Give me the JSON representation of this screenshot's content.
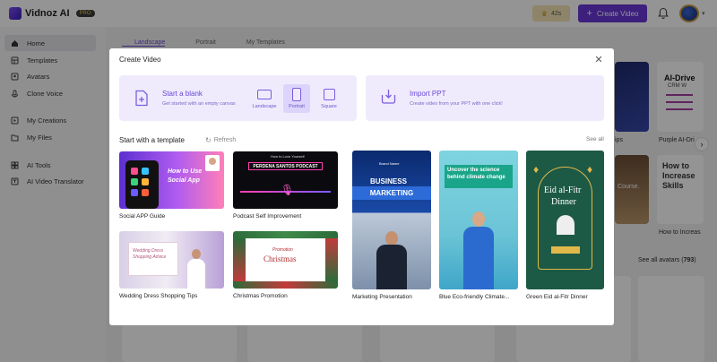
{
  "app": {
    "name": "Vidnoz AI",
    "badge": "PRO"
  },
  "topbar": {
    "credits": "42s",
    "create_label": "Create Video"
  },
  "sidebar": {
    "items": [
      {
        "label": "Home",
        "icon": "home-icon"
      },
      {
        "label": "Templates",
        "icon": "templates-icon"
      },
      {
        "label": "Avatars",
        "icon": "avatars-icon"
      },
      {
        "label": "Clone Voice",
        "icon": "voice-icon"
      },
      {
        "label": "My Creations",
        "icon": "creations-icon"
      },
      {
        "label": "My Files",
        "icon": "files-icon"
      },
      {
        "label": "AI Tools",
        "icon": "tools-icon"
      },
      {
        "label": "AI Video Translator",
        "icon": "translator-icon"
      }
    ]
  },
  "background": {
    "tabs": [
      "Landscape",
      "Portrait",
      "My Templates"
    ],
    "right_labels": [
      "ips",
      "Purple AI-Dri",
      "How to Increas"
    ],
    "see_all_avatars": "See all avatars",
    "avatar_count": "793",
    "card_texts": {
      "ai_driven": "AI-Drive",
      "crm": "CRM W",
      "course": "Course.",
      "how_to": "How to",
      "increase": "Increase",
      "skills": "Skills"
    }
  },
  "modal": {
    "title": "Create Video",
    "blank": {
      "title": "Start a blank",
      "subtitle": "Get started with an empty canvas"
    },
    "ratios": [
      {
        "label": "Landscape",
        "selected": false
      },
      {
        "label": "Portrait",
        "selected": true
      },
      {
        "label": "Square",
        "selected": false
      }
    ],
    "ppt": {
      "title": "Import PPT",
      "subtitle": "Create video from your PPT with one click!"
    },
    "section_title": "Start with a template",
    "refresh_label": "Refresh",
    "see_all_label": "See all",
    "templates": [
      {
        "label": "Social APP Guide",
        "text": "How to Use Social App"
      },
      {
        "label": "Podcast Self Improvement",
        "text": "PERDENA SANTOS PODCAST",
        "sub": "How to Love Yourself"
      },
      {
        "label": "Wedding Dress Shopping Tips",
        "text": "Wedding Dress Shopping Advice"
      },
      {
        "label": "Christmas Promotion",
        "text": "Christmas",
        "sub": "Promotion"
      },
      {
        "label": "Marketing Presentation",
        "text": "BUSINESS",
        "text2": "MARKETING",
        "brand": "Brand Name"
      },
      {
        "label": "Blue Eco-friendly Climate...",
        "text": "Uncover the science",
        "text2": "behind climate change"
      },
      {
        "label": "Green Eid al-Fitr Dinner",
        "text": "Eid al-Fitr",
        "text2": "Dinner"
      }
    ]
  }
}
